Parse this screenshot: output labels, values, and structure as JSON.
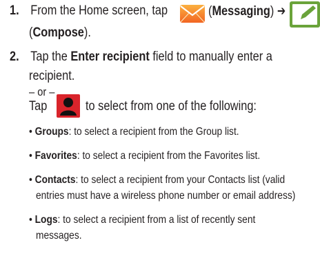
{
  "step1": {
    "number": "1.",
    "text_a": "From the Home screen, tap",
    "paren_open_a": "(",
    "messaging": "Messaging",
    "paren_close_arrow": ") ➔",
    "paren_open_b": "(",
    "compose": "Compose",
    "paren_close_b": ")."
  },
  "step2": {
    "number": "2.",
    "text_a": "Tap the ",
    "enter_recipient": "Enter recipient",
    "text_b": " field to manually enter a",
    "text_c": "recipient.",
    "or": "– or –",
    "tap": "Tap",
    "tap_rest": "to select from one of the following:"
  },
  "bullets": [
    {
      "term": "Groups",
      "line1": ": to select a recipient from the Group list.",
      "line2": ""
    },
    {
      "term": "Favorites",
      "line1": ": to select a recipient from the Favorites list.",
      "line2": ""
    },
    {
      "term": "Contacts",
      "line1": ": to select a recipient from your Contacts list (valid",
      "line2": "entries must have a wireless phone number or email address)"
    },
    {
      "term": "Logs",
      "line1": ": to select a recipient from a list of recently sent",
      "line2": "messages."
    }
  ],
  "colors": {
    "text": "#231f20",
    "heading": "#1a6fae",
    "messaging_icon": "#f7941d",
    "compose_icon": "#5a8f2e",
    "contact_icon": "#d9242b"
  }
}
